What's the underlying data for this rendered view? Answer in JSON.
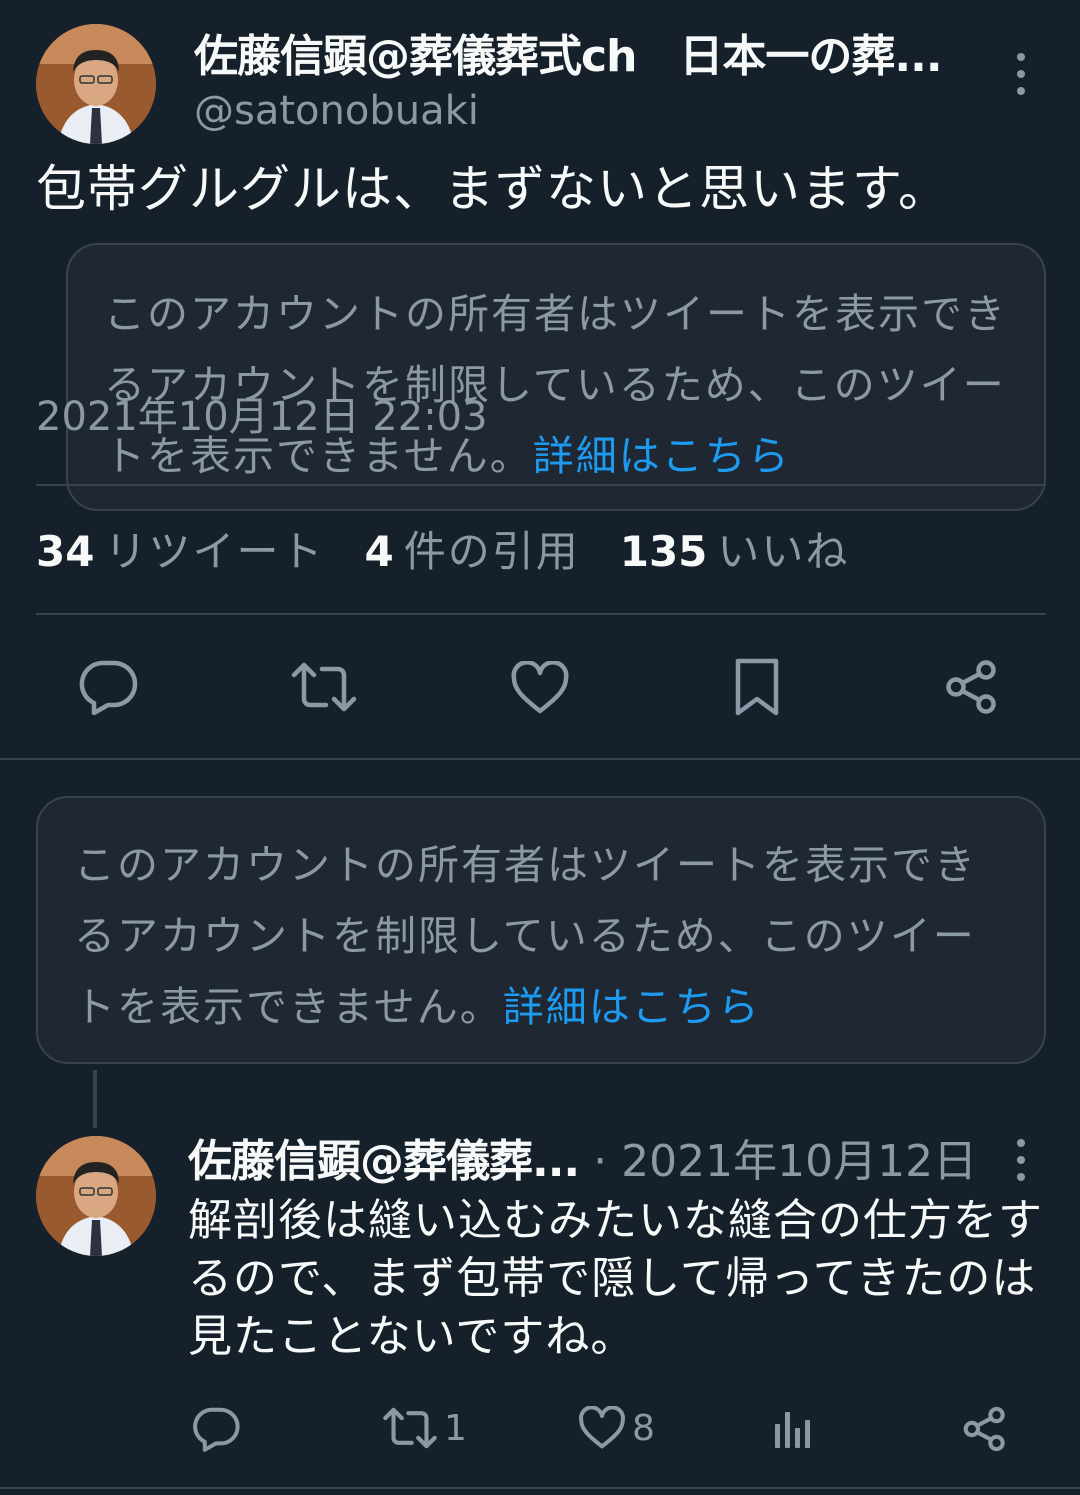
{
  "main_tweet": {
    "display_name": "佐藤信顕@葬儀葬式ch　日本一の葬...",
    "handle": "@satonobuaki",
    "text": "包帯グルグルは、まずないと思います。",
    "quoted_card": {
      "message": "このアカウントの所有者はツイートを表示できるアカウントを制限しているため、このツイートを表示できません。",
      "link": "詳細はこちら"
    },
    "timestamp": "2021年10月12日 22:03",
    "stats": {
      "retweets_count": "34",
      "retweets_label": "リツイート",
      "quotes_count": "4",
      "quotes_label": "件の引用",
      "likes_count": "135",
      "likes_label": "いいね"
    }
  },
  "restricted_card": {
    "message": "このアカウントの所有者はツイートを表示できるアカウントを制限しているため、このツイートを表示できません。",
    "link": "詳細はこちら"
  },
  "reply_tweet": {
    "display_name": "佐藤信顕@葬儀葬...",
    "meta": " · 2021年10月12日",
    "text": "解剖後は縫い込むみたいな縫合の仕方をするので、まず包帯で隠して帰ってきたのは見たことないですね。",
    "retweet_count": "1",
    "like_count": "8"
  },
  "icons": [
    "reply-icon",
    "retweet-icon",
    "like-icon",
    "bookmark-icon",
    "share-icon",
    "analytics-icon",
    "more-icon"
  ],
  "colors": {
    "background": "#15202b",
    "text": "#f7f9f9",
    "secondary": "#8b98a5",
    "link": "#1d9bf0",
    "border": "#38444d"
  }
}
